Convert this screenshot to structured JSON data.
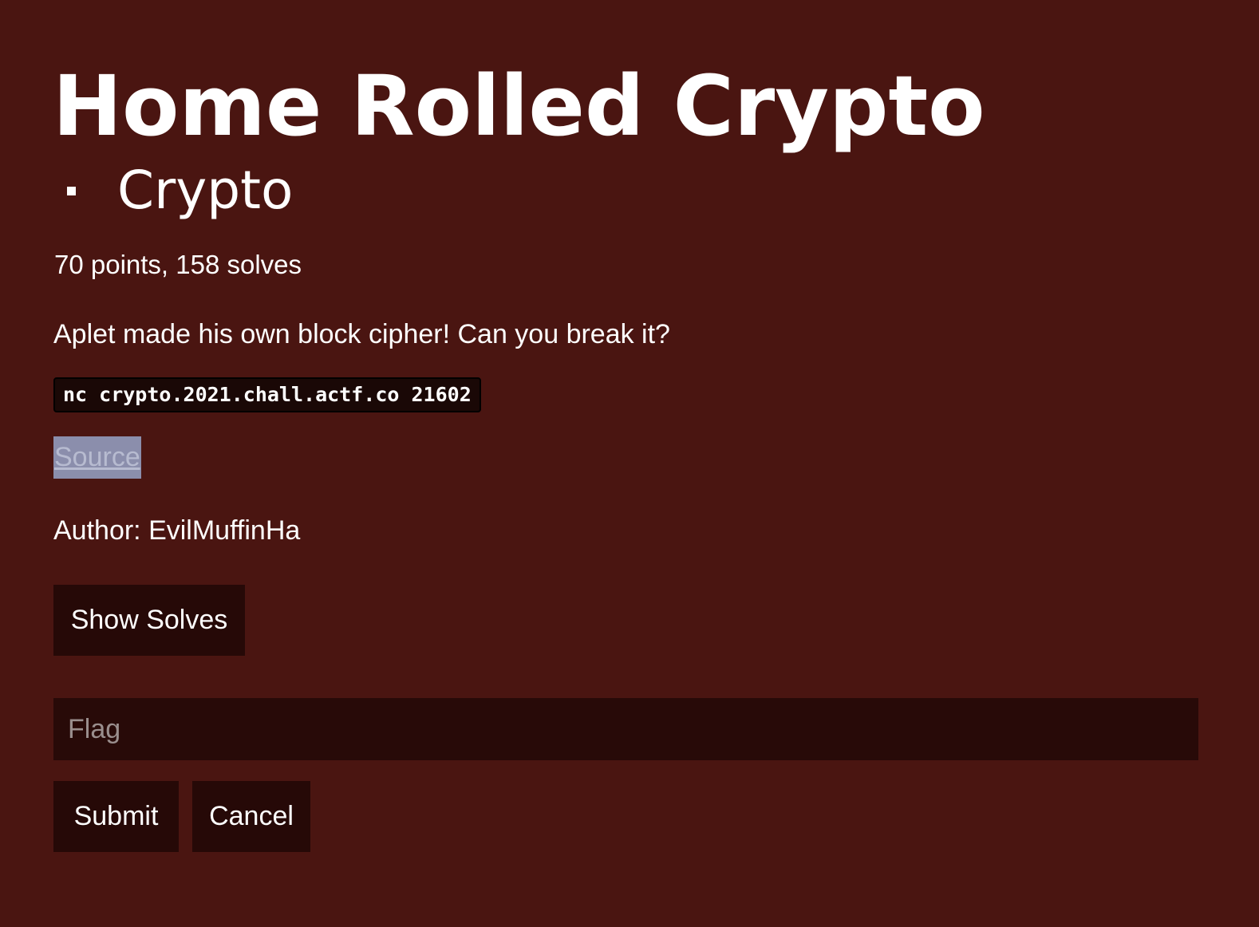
{
  "challenge": {
    "title": "Home Rolled Crypto",
    "categories": [
      "Crypto"
    ],
    "meta": "70 points, 158 solves",
    "description": "Aplet made his own block cipher! Can you break it?",
    "command": "nc crypto.2021.chall.actf.co 21602",
    "source_link": "Source",
    "author": "Author: EvilMuffinHa"
  },
  "actions": {
    "show_solves": "Show Solves",
    "submit": "Submit",
    "cancel": "Cancel"
  },
  "flag_input": {
    "placeholder": "Flag",
    "value": ""
  },
  "colors": {
    "background": "#4a1511",
    "button": "#260907",
    "input": "#280a08",
    "link_highlight": "#8b8eac"
  }
}
